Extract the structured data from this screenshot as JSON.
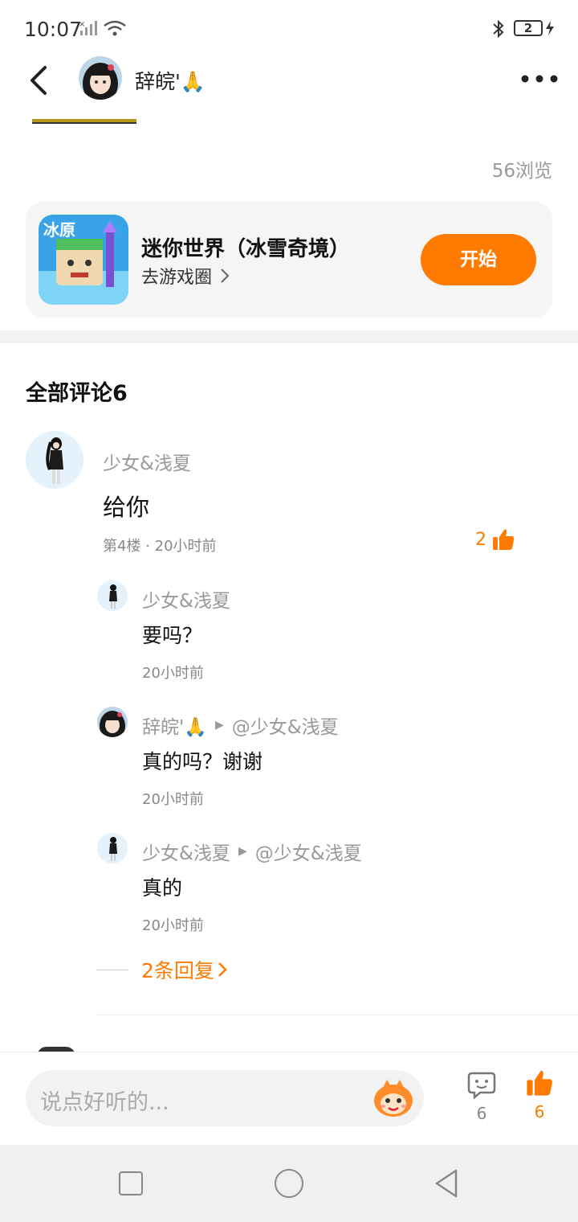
{
  "status_bar": {
    "time": "10:07",
    "battery": "2"
  },
  "header": {
    "username": "辞皖'🙏"
  },
  "post": {
    "views": "56浏览"
  },
  "game_card": {
    "title": "迷你世界（冰雪奇境）",
    "link_label": "去游戏圈",
    "button_label": "开始",
    "icon_text": "冰原"
  },
  "comments_section": {
    "title": "全部评论6"
  },
  "comment": {
    "author": "少女&浅夏",
    "text": "给你",
    "meta": "第4楼 · 20小时前",
    "likes": "2",
    "replies": [
      {
        "author": "少女&浅夏",
        "reply_to": "",
        "text": "要吗？",
        "time": "20小时前"
      },
      {
        "author": "辞皖'🙏",
        "reply_to": "@少女&浅夏",
        "text": "真的吗？谢谢",
        "time": "20小时前"
      },
      {
        "author": "少女&浅夏",
        "reply_to": "@少女&浅夏",
        "text": "真的",
        "time": "20小时前"
      }
    ],
    "more_replies": "2条回复"
  },
  "bottom_bar": {
    "placeholder": "说点好听的...",
    "comment_count": "6",
    "like_count": "6"
  },
  "colors": {
    "accent": "#ff7a00",
    "muted": "#999999",
    "card_bg": "#f5f5f5"
  },
  "icons": [
    "back-arrow-icon",
    "more-dots-icon",
    "bluetooth-icon",
    "wifi-icon",
    "signal-icon",
    "chevron-right-icon",
    "thumbs-up-icon",
    "comment-bubble-icon",
    "mascot-icon"
  ]
}
